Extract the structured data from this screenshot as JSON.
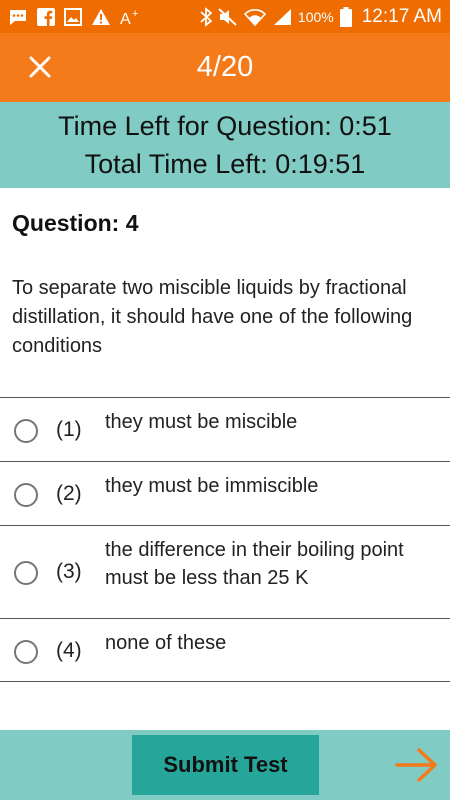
{
  "status_bar": {
    "battery_percent": "100%",
    "time": "12:17 AM",
    "icons": [
      "messages-icon",
      "facebook-icon",
      "gallery-icon",
      "warning-icon",
      "font-size-icon",
      "bluetooth-icon",
      "mute-icon",
      "wifi-icon",
      "signal-icon",
      "battery-icon"
    ]
  },
  "app_bar": {
    "progress": "4/20",
    "close_icon": "close-icon"
  },
  "timer": {
    "question_time": "Time Left for Question: 0:51",
    "total_time": "Total Time Left: 0:19:51"
  },
  "question": {
    "heading": "Question: 4",
    "text": "To separate two miscible liquids by fractional distillation, it should have one of the following conditions"
  },
  "options": [
    {
      "number": "(1)",
      "text": "they must be miscible"
    },
    {
      "number": "(2)",
      "text": "they must be immiscible"
    },
    {
      "number": "(3)",
      "text": "the difference in their boiling point must be less than 25 K"
    },
    {
      "number": "(4)",
      "text": "none of these"
    }
  ],
  "footer": {
    "submit_label": "Submit Test",
    "next_icon": "arrow-right-icon"
  },
  "colors": {
    "status_bar": "#ee6c00",
    "app_bar": "#f47a1a",
    "timer_band": "#80cbc4",
    "submit_button": "#26a69a",
    "next_arrow": "#f47a1a"
  }
}
